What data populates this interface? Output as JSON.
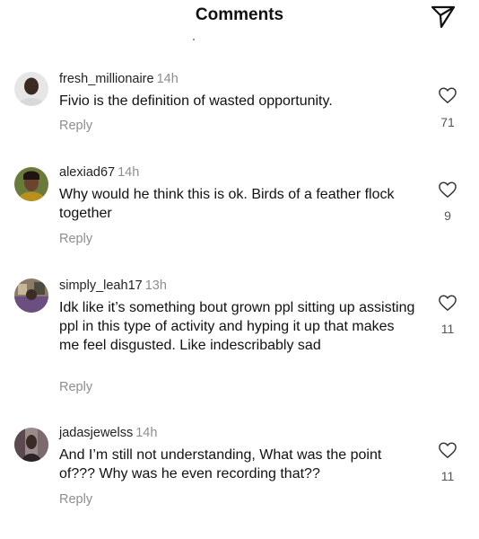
{
  "header": {
    "title": "Comments"
  },
  "comments": [
    {
      "username": "fresh_millionaire",
      "time": "14h",
      "text": "Fivio is the definition of wasted opportunity.",
      "reply_label": "Reply",
      "likes": "71"
    },
    {
      "username": "alexiad67",
      "time": "14h",
      "text": "Why would he think this is ok. Birds of a feather flock together",
      "reply_label": "Reply",
      "likes": "9"
    },
    {
      "username": "simply_leah17",
      "time": "13h",
      "text": "Idk like it’s something bout grown ppl sitting up assisting ppl in this type of activity and hyping it up that makes me feel disgusted. Like indescribably sad",
      "reply_label": "Reply",
      "likes": "11"
    },
    {
      "username": "jadasjewelss",
      "time": "14h",
      "text": "And I’m still not understanding, What was the point of??? Why was he even recording that??",
      "reply_label": "Reply",
      "likes": "11"
    }
  ]
}
